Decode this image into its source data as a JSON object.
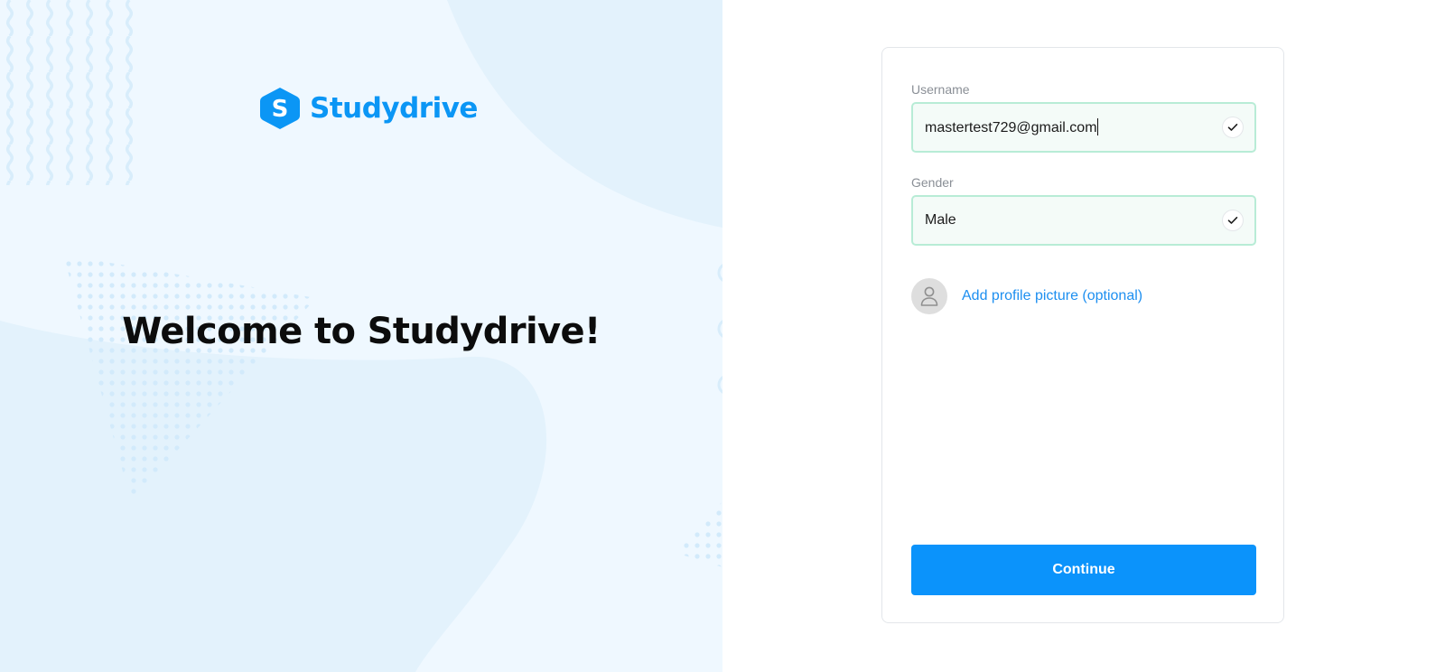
{
  "brand": {
    "name": "Studydrive",
    "mark_letter": "S",
    "color": "#0b96f5"
  },
  "hero": {
    "title": "Welcome to Studydrive!",
    "background_color": "#eff8ff"
  },
  "form": {
    "username": {
      "label": "Username",
      "value": "mastertest729@gmail.com",
      "status_icon": "check-icon"
    },
    "gender": {
      "label": "Gender",
      "value": "Male",
      "status_icon": "check-icon"
    },
    "profile_picture": {
      "icon": "user-icon",
      "link_label": "Add profile picture (optional)"
    },
    "continue_label": "Continue",
    "accent_color": "#0b93fb",
    "valid_border_color": "#b8ecd6"
  }
}
